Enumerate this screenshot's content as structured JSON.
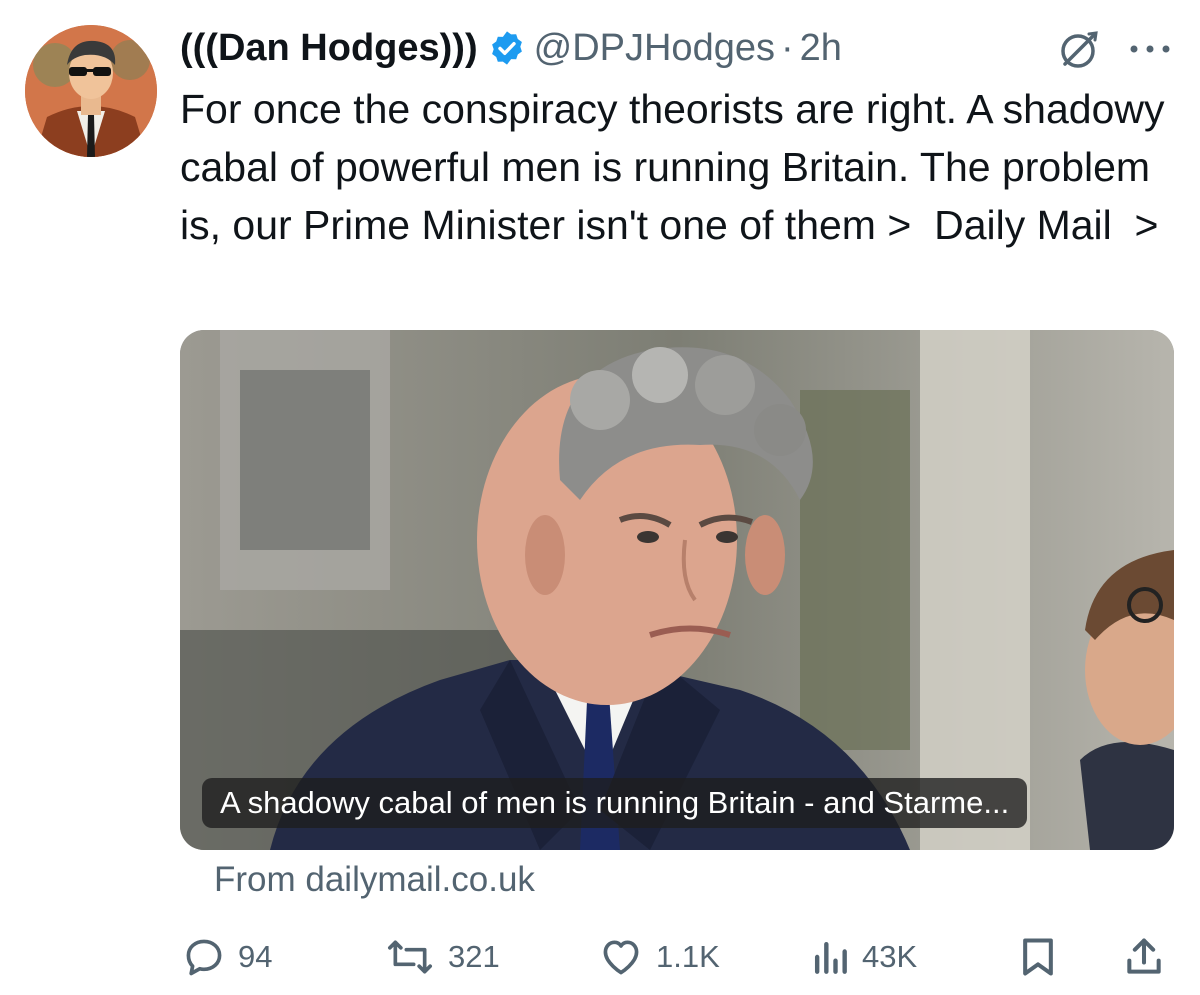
{
  "author": {
    "display_name": "(((Dan Hodges)))",
    "handle": "@DPJHodges",
    "separator": "·",
    "time": "2h"
  },
  "tweet": {
    "line1": "For once the conspiracy theorists are right. A shadowy cabal of powerful men is running Britain. The problem is, our Prime Minister isn't one of them",
    "tail": " >  Daily Mail  >"
  },
  "card": {
    "caption": "A shadowy cabal of men is running Britain - and Starme...",
    "source": "From dailymail.co.uk"
  },
  "actions": {
    "replies": "94",
    "reposts": "321",
    "likes": "1.1K",
    "views": "43K"
  },
  "icons": {
    "verified": "verified-badge-icon",
    "grok": "grok-icon",
    "more": "more-dots-icon",
    "reply": "reply-icon",
    "repost": "repost-icon",
    "like": "heart-icon",
    "views": "views-chart-icon",
    "bookmark": "bookmark-icon",
    "share": "share-icon"
  },
  "colors": {
    "text": "#0f1419",
    "secondary": "#536471",
    "verified": "#1d9bf0"
  }
}
